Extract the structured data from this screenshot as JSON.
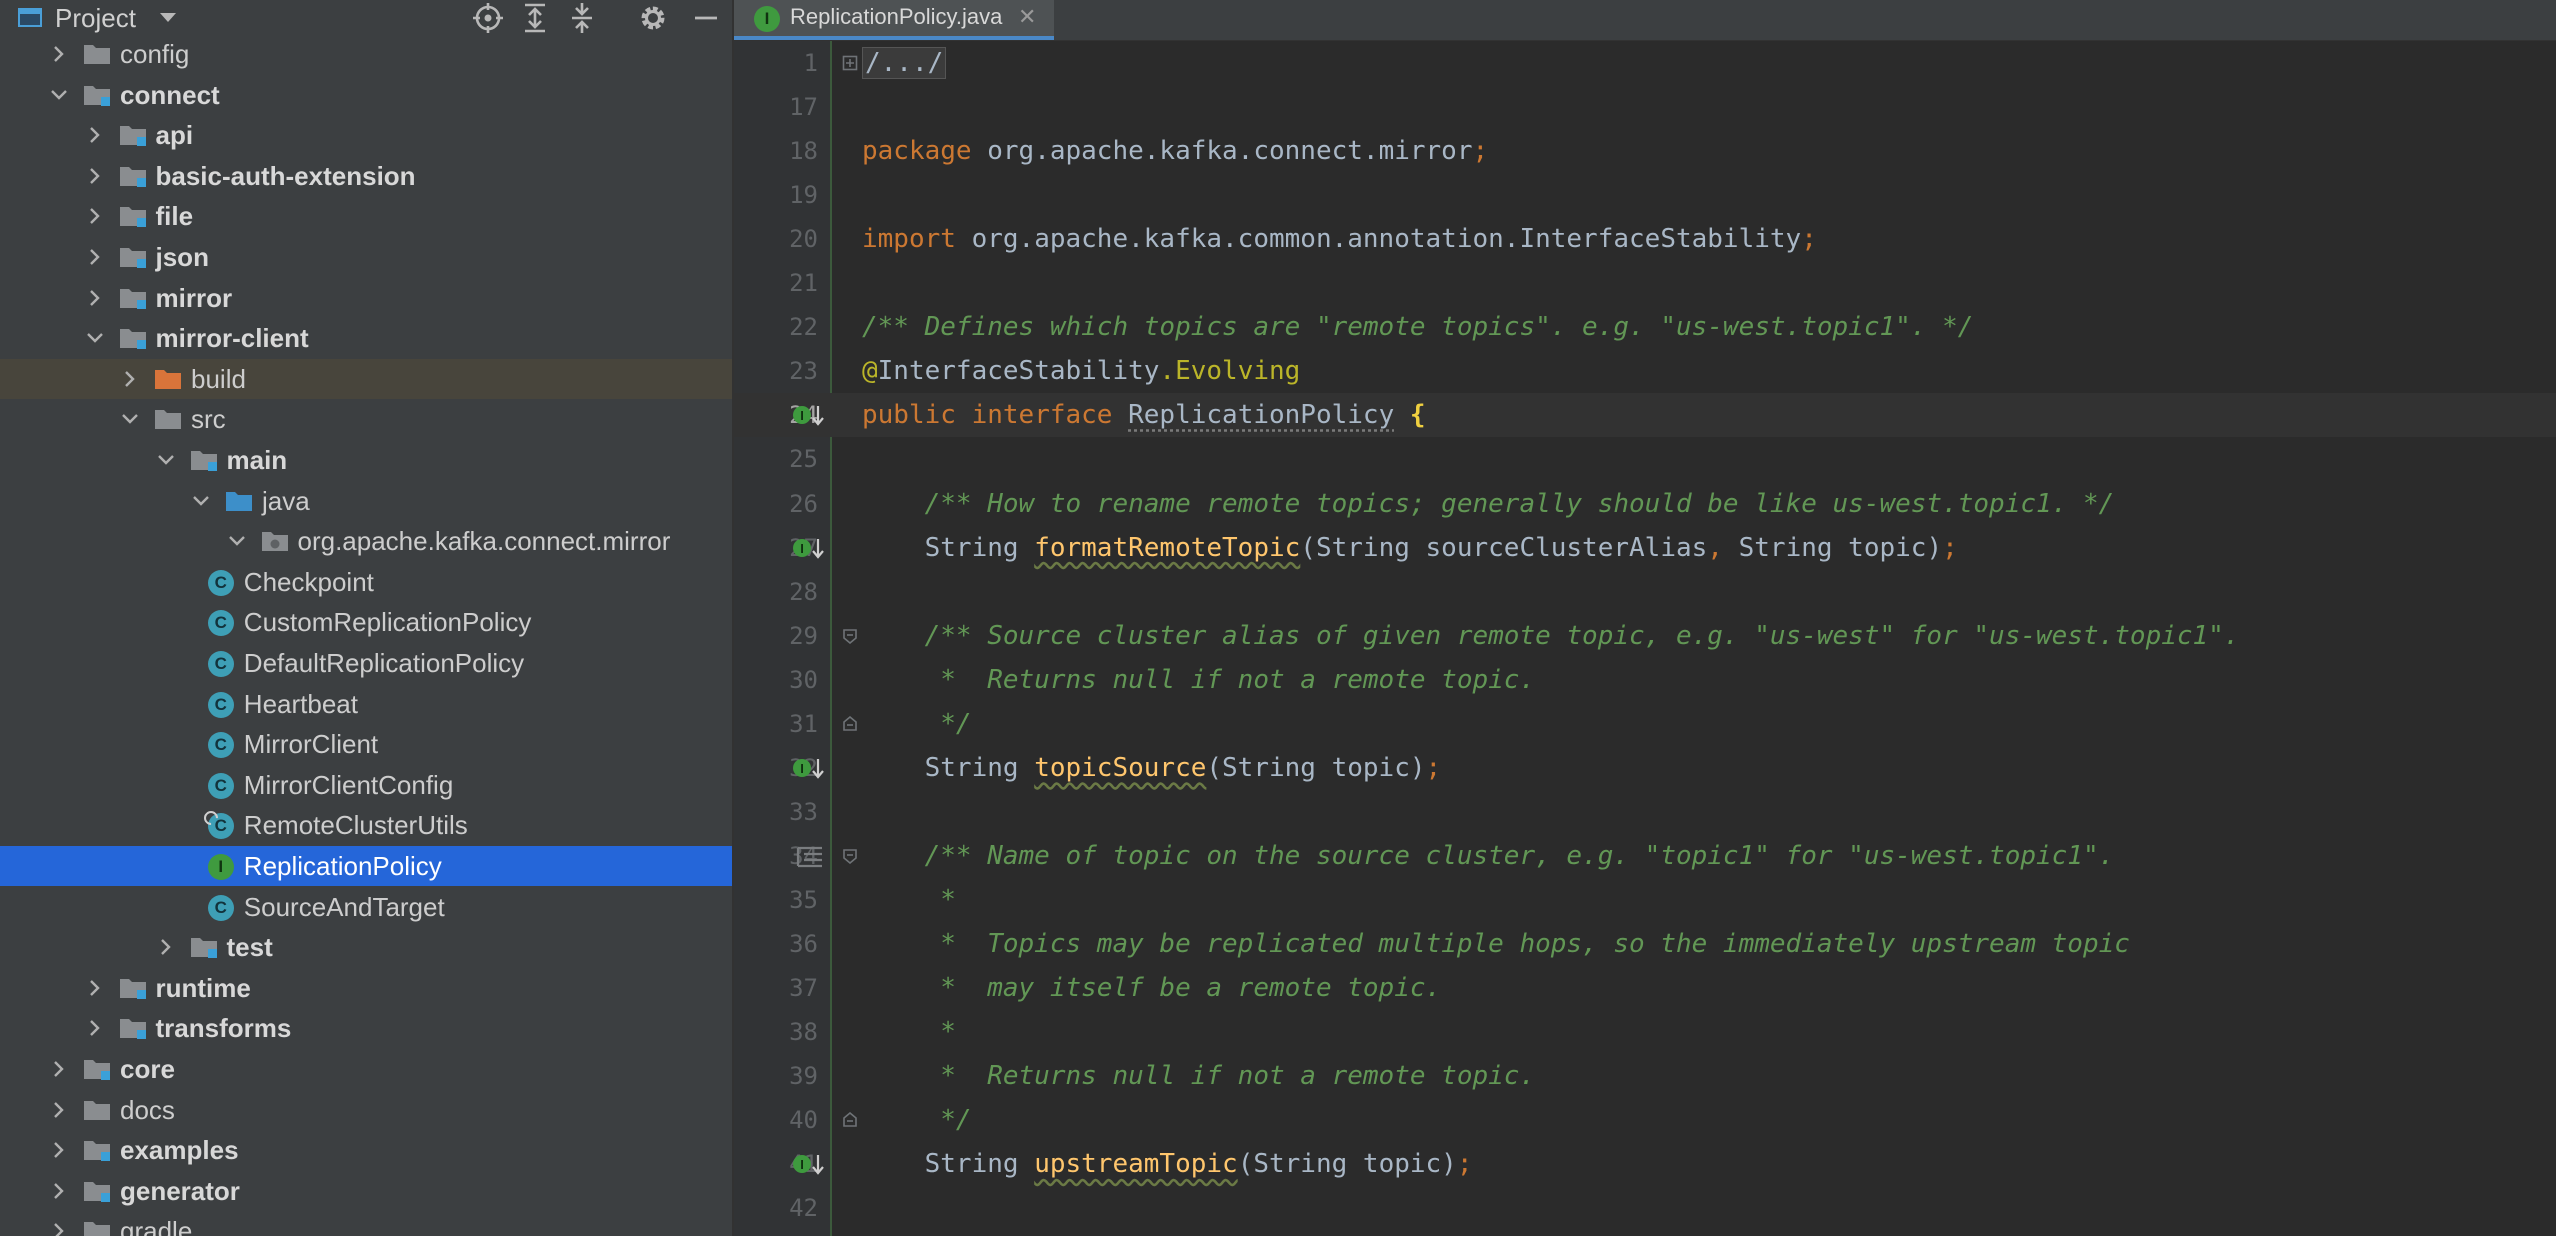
{
  "project_panel": {
    "title": "Project",
    "toolbar": [
      "locate-icon",
      "expand-all-icon",
      "collapse-all-icon",
      "gear-icon",
      "minimize-icon"
    ],
    "tree": [
      {
        "label": "config",
        "depth": 0,
        "expanded": false,
        "icon": "folder",
        "bold": false
      },
      {
        "label": "connect",
        "depth": 0,
        "expanded": true,
        "icon": "module-folder",
        "bold": true
      },
      {
        "label": "api",
        "depth": 1,
        "expanded": false,
        "icon": "module-folder",
        "bold": true
      },
      {
        "label": "basic-auth-extension",
        "depth": 1,
        "expanded": false,
        "icon": "module-folder",
        "bold": true
      },
      {
        "label": "file",
        "depth": 1,
        "expanded": false,
        "icon": "module-folder",
        "bold": true
      },
      {
        "label": "json",
        "depth": 1,
        "expanded": false,
        "icon": "module-folder",
        "bold": true
      },
      {
        "label": "mirror",
        "depth": 1,
        "expanded": false,
        "icon": "module-folder",
        "bold": true
      },
      {
        "label": "mirror-client",
        "depth": 1,
        "expanded": true,
        "icon": "module-folder",
        "bold": true
      },
      {
        "label": "build",
        "depth": 2,
        "expanded": false,
        "icon": "excluded-folder",
        "bold": false
      },
      {
        "label": "src",
        "depth": 2,
        "expanded": true,
        "icon": "folder",
        "bold": false
      },
      {
        "label": "main",
        "depth": 3,
        "expanded": true,
        "icon": "module-folder",
        "bold": true
      },
      {
        "label": "java",
        "depth": 4,
        "expanded": true,
        "icon": "source-folder",
        "bold": false
      },
      {
        "label": "org.apache.kafka.connect.mirror",
        "depth": 5,
        "expanded": true,
        "icon": "package",
        "bold": false
      },
      {
        "label": "Checkpoint",
        "depth": 6,
        "icon": "class",
        "letter": "C"
      },
      {
        "label": "CustomReplicationPolicy",
        "depth": 6,
        "icon": "class",
        "letter": "C"
      },
      {
        "label": "DefaultReplicationPolicy",
        "depth": 6,
        "icon": "class",
        "letter": "C"
      },
      {
        "label": "Heartbeat",
        "depth": 6,
        "icon": "class",
        "letter": "C"
      },
      {
        "label": "MirrorClient",
        "depth": 6,
        "icon": "class",
        "letter": "C"
      },
      {
        "label": "MirrorClientConfig",
        "depth": 6,
        "icon": "class",
        "letter": "C"
      },
      {
        "label": "RemoteClusterUtils",
        "depth": 6,
        "icon": "class-final",
        "letter": "C"
      },
      {
        "label": "ReplicationPolicy",
        "depth": 6,
        "icon": "interface",
        "letter": "I",
        "selected": true
      },
      {
        "label": "SourceAndTarget",
        "depth": 6,
        "icon": "class",
        "letter": "C"
      },
      {
        "label": "test",
        "depth": 3,
        "expanded": false,
        "icon": "module-folder",
        "bold": true
      },
      {
        "label": "runtime",
        "depth": 1,
        "expanded": false,
        "icon": "module-folder",
        "bold": true
      },
      {
        "label": "transforms",
        "depth": 1,
        "expanded": false,
        "icon": "module-folder",
        "bold": true
      },
      {
        "label": "core",
        "depth": 0,
        "expanded": false,
        "icon": "module-folder",
        "bold": true
      },
      {
        "label": "docs",
        "depth": 0,
        "expanded": false,
        "icon": "folder",
        "bold": false
      },
      {
        "label": "examples",
        "depth": 0,
        "expanded": false,
        "icon": "module-folder",
        "bold": true
      },
      {
        "label": "generator",
        "depth": 0,
        "expanded": false,
        "icon": "module-folder",
        "bold": true
      },
      {
        "label": "gradle",
        "depth": 0,
        "expanded": false,
        "icon": "folder",
        "bold": false
      }
    ]
  },
  "editor": {
    "tab": {
      "label": "ReplicationPolicy.java",
      "icon_letter": "I"
    },
    "lines": [
      {
        "n": "1",
        "tokens": [
          {
            "t": "/.../",
            "k": "folded"
          }
        ],
        "fold": "expand"
      },
      {
        "n": "17",
        "tokens": []
      },
      {
        "n": "18",
        "tokens": [
          {
            "t": "package",
            "k": "keyword"
          },
          {
            "t": " org.apache.kafka.connect.mirror",
            "k": "plain"
          },
          {
            "t": ";",
            "k": "punct"
          }
        ]
      },
      {
        "n": "19",
        "tokens": []
      },
      {
        "n": "20",
        "tokens": [
          {
            "t": "import",
            "k": "keyword"
          },
          {
            "t": " org.apache.kafka.common.annotation.InterfaceStability",
            "k": "plain"
          },
          {
            "t": ";",
            "k": "punct"
          }
        ]
      },
      {
        "n": "21",
        "tokens": []
      },
      {
        "n": "22",
        "tokens": [
          {
            "t": "/** Defines which topics are \"remote topics\". e.g. \"us-west.topic1\". */",
            "k": "comment"
          }
        ]
      },
      {
        "n": "23",
        "tokens": [
          {
            "t": "@",
            "k": "annot"
          },
          {
            "t": "InterfaceStability",
            "k": "plain"
          },
          {
            "t": ".Evolving",
            "k": "annot"
          }
        ]
      },
      {
        "n": "24",
        "current": true,
        "marker": "implemented",
        "tokens": [
          {
            "t": "public",
            "k": "keyword"
          },
          {
            "t": " ",
            "k": "plain"
          },
          {
            "t": "interface",
            "k": "keyword"
          },
          {
            "t": " ",
            "k": "plain"
          },
          {
            "t": "ReplicationPolicy",
            "k": "iface"
          },
          {
            "t": " ",
            "k": "plain"
          },
          {
            "t": "{",
            "k": "brace"
          }
        ]
      },
      {
        "n": "25",
        "tokens": []
      },
      {
        "n": "26",
        "tokens": [
          {
            "t": "    /** How to rename remote topics; generally should be like us-west.topic1. */",
            "k": "comment"
          }
        ]
      },
      {
        "n": "27",
        "marker": "implemented",
        "tokens": [
          {
            "t": "    String ",
            "k": "plain"
          },
          {
            "t": "formatRemoteTopic",
            "k": "method"
          },
          {
            "t": "(String sourceClusterAlias",
            "k": "plain"
          },
          {
            "t": ",",
            "k": "punct"
          },
          {
            "t": " String topic)",
            "k": "plain"
          },
          {
            "t": ";",
            "k": "punct"
          }
        ]
      },
      {
        "n": "28",
        "tokens": []
      },
      {
        "n": "29",
        "fold": "start",
        "tokens": [
          {
            "t": "    /** Source cluster alias of given remote topic, e.g. \"us-west\" for \"us-west.topic1\".",
            "k": "comment"
          }
        ]
      },
      {
        "n": "30",
        "tokens": [
          {
            "t": "     *  Returns null if not a remote topic.",
            "k": "comment"
          }
        ]
      },
      {
        "n": "31",
        "fold": "end",
        "tokens": [
          {
            "t": "     */",
            "k": "comment"
          }
        ]
      },
      {
        "n": "32",
        "marker": "implemented",
        "tokens": [
          {
            "t": "    String ",
            "k": "plain"
          },
          {
            "t": "topicSource",
            "k": "method"
          },
          {
            "t": "(String topic)",
            "k": "plain"
          },
          {
            "t": ";",
            "k": "punct"
          }
        ]
      },
      {
        "n": "33",
        "tokens": []
      },
      {
        "n": "34",
        "fold": "start",
        "marker": "doc",
        "tokens": [
          {
            "t": "    /** Name of topic on the source cluster, e.g. \"topic1\" for \"us-west.topic1\".",
            "k": "comment"
          }
        ]
      },
      {
        "n": "35",
        "tokens": [
          {
            "t": "     *",
            "k": "comment"
          }
        ]
      },
      {
        "n": "36",
        "tokens": [
          {
            "t": "     *  Topics may be replicated multiple hops, so the immediately upstream topic",
            "k": "comment"
          }
        ]
      },
      {
        "n": "37",
        "tokens": [
          {
            "t": "     *  may itself be a remote topic.",
            "k": "comment"
          }
        ]
      },
      {
        "n": "38",
        "tokens": [
          {
            "t": "     *",
            "k": "comment"
          }
        ]
      },
      {
        "n": "39",
        "tokens": [
          {
            "t": "     *  Returns null if not a remote topic.",
            "k": "comment"
          }
        ]
      },
      {
        "n": "40",
        "fold": "end",
        "tokens": [
          {
            "t": "     */",
            "k": "comment"
          }
        ]
      },
      {
        "n": "41",
        "marker": "implemented",
        "tokens": [
          {
            "t": "    String ",
            "k": "plain"
          },
          {
            "t": "upstreamTopic",
            "k": "method"
          },
          {
            "t": "(String topic)",
            "k": "plain"
          },
          {
            "t": ";",
            "k": "punct"
          }
        ]
      },
      {
        "n": "42",
        "tokens": []
      }
    ]
  }
}
